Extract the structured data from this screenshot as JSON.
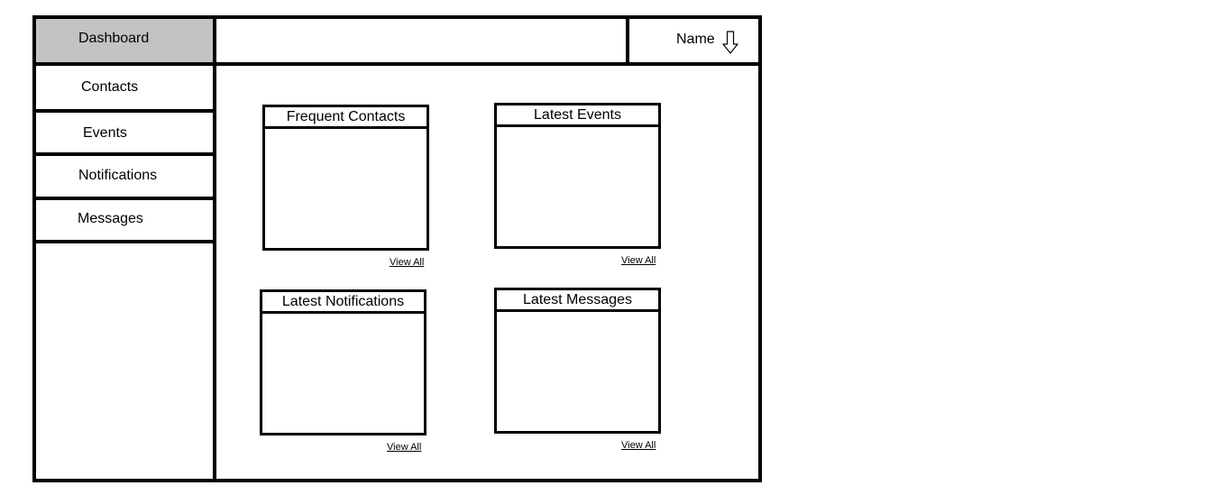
{
  "sidebar": {
    "items": [
      {
        "label": "Dashboard",
        "active": true
      },
      {
        "label": "Contacts"
      },
      {
        "label": "Events"
      },
      {
        "label": "Notifications"
      },
      {
        "label": "Messages"
      }
    ]
  },
  "header": {
    "user_name": "Name",
    "user_menu_icon": "arrow-down-outline-icon"
  },
  "widgets": [
    {
      "title": "Frequent Contacts",
      "link": "View All"
    },
    {
      "title": "Latest Events",
      "link": "View All"
    },
    {
      "title": "Latest Notifications",
      "link": "View All"
    },
    {
      "title": "Latest Messages",
      "link": "View All"
    }
  ],
  "colors": {
    "border": "#000000",
    "active_nav_bg": "#c3c3c3",
    "background": "#ffffff"
  }
}
